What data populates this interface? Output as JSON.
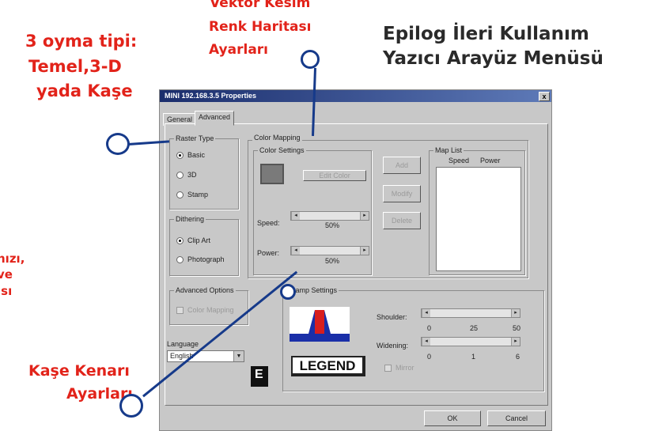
{
  "annotations": {
    "vector_title": [
      "Vektör Kesim",
      "Renk Haritası",
      "Ayarları"
    ],
    "header": [
      "Epilog İleri Kullanım",
      "Yazıcı Arayüz Menüsü"
    ],
    "raster_types": [
      "3 oyma tipi:",
      "Temel,3-D",
      "yada Kaşe"
    ],
    "left_cut": [
      "hızı,",
      "ve",
      "ısı"
    ],
    "stamp_edge": [
      "Kaşe Kenarı",
      "Ayarları"
    ]
  },
  "dialog": {
    "title": "MINI 192.168.3.5 Properties",
    "close": "x",
    "tabs": [
      "General",
      "Advanced"
    ],
    "raster_type": {
      "title": "Raster Type",
      "options": [
        "Basic",
        "3D",
        "Stamp"
      ],
      "selected": "Basic"
    },
    "dithering": {
      "title": "Dithering",
      "options": [
        "Clip Art",
        "Photograph"
      ],
      "selected": "Clip Art"
    },
    "color_mapping": {
      "title": "Color Mapping",
      "color_settings": "Color Settings",
      "edit_color": "Edit Color",
      "speed_label": "Speed:",
      "speed_value": "50%",
      "power_label": "Power:",
      "power_value": "50%",
      "buttons": [
        "Add",
        "Modify",
        "Delete"
      ],
      "map_list": {
        "title": "Map List",
        "columns": [
          "Speed",
          "Power"
        ]
      }
    },
    "advanced_options": {
      "title": "Advanced Options",
      "color_mapping_check": "Color Mapping"
    },
    "stamp_settings": {
      "title": "Stamp Settings",
      "shoulder_label": "Shoulder:",
      "shoulder_ticks": [
        "0",
        "25",
        "50"
      ],
      "widening_label": "Widening:",
      "widening_ticks": [
        "0",
        "1",
        "6"
      ],
      "legend_text": "LEGEND",
      "mirror": "Mirror"
    },
    "language": {
      "title": "Language",
      "value": "English"
    },
    "ok": "OK",
    "cancel": "Cancel"
  },
  "colors": {
    "annotation_red": "#e2231a",
    "annotation_dark": "#2a2a2a",
    "pointer_blue": "#163a8a",
    "dialog_gray": "#c8c8c8"
  }
}
